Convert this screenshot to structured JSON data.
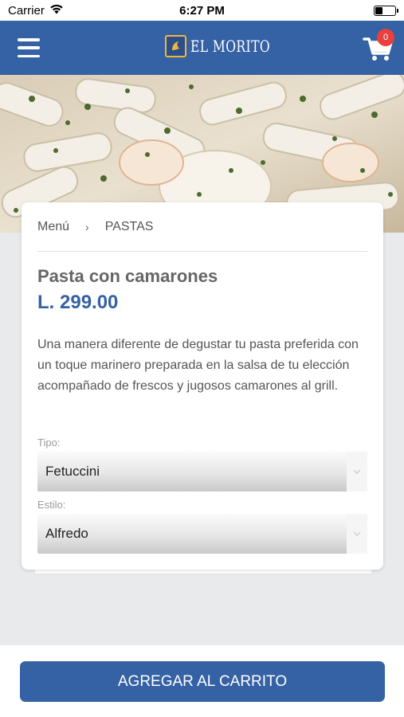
{
  "status_bar": {
    "carrier": "Carrier",
    "time": "6:27 PM",
    "battery_level": 0.35
  },
  "nav": {
    "logo_text": "EL MORITO",
    "cart_count": "0"
  },
  "breadcrumb": {
    "root": "Menú",
    "separator": "›",
    "current": "PASTAS"
  },
  "product": {
    "name": "Pasta con camarones",
    "price": "L. 299.00",
    "description": "Una manera diferente de degustar tu pasta preferida con un toque marinero preparada en la salsa de tu elección acompañado de frescos y jugosos camarones al grill."
  },
  "options": {
    "tipo": {
      "label": "Tipo:",
      "value": "Fetuccini"
    },
    "estilo": {
      "label": "Estilo:",
      "value": "Alfredo"
    }
  },
  "actions": {
    "add_to_cart": "AGREGAR AL CARRITO"
  },
  "colors": {
    "primary": "#3561a5",
    "badge": "#e8403c",
    "logo_accent": "#f0b63c"
  },
  "icons": [
    "wifi-icon",
    "battery-icon",
    "hamburger-menu-icon",
    "logo-icon",
    "cart-icon",
    "chevron-down-icon"
  ]
}
